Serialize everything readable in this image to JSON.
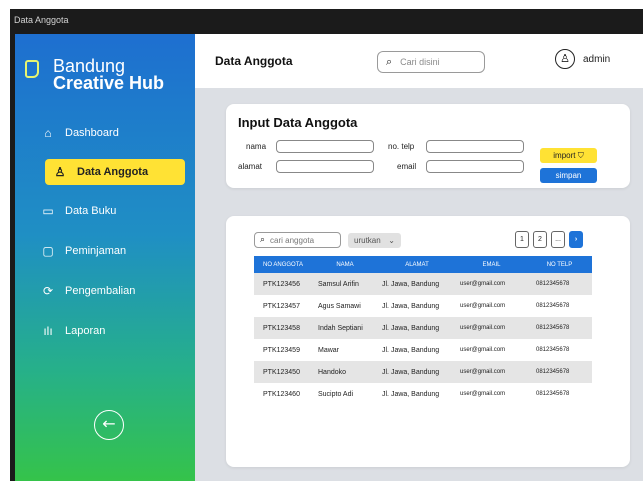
{
  "window": {
    "title": "Data Anggota"
  },
  "sidebar": {
    "brand_line1": "Bandung",
    "brand_line2": "Creative Hub",
    "items": [
      {
        "label": "Dashboard",
        "icon": "home-icon",
        "active": false
      },
      {
        "label": "Data Anggota",
        "icon": "user-icon",
        "active": true
      },
      {
        "label": "Data Buku",
        "icon": "book-icon",
        "active": false
      },
      {
        "label": "Peminjaman",
        "icon": "folder-icon",
        "active": false
      },
      {
        "label": "Pengembalian",
        "icon": "refresh-icon",
        "active": false
      },
      {
        "label": "Laporan",
        "icon": "bar-chart-icon",
        "active": false
      }
    ],
    "back_icon": "arrow-left-circle-icon"
  },
  "header": {
    "title": "Data Anggota",
    "search_placeholder": "Cari disini",
    "user_name": "admin"
  },
  "form": {
    "heading": "Input Data Anggota",
    "nama_label": "nama",
    "alamat_label": "alamat",
    "telp_label": "no. telp",
    "email_label": "email",
    "nama_value": "",
    "alamat_value": "",
    "telp_value": "",
    "email_value": "",
    "import_label": "import",
    "save_label": "simpan"
  },
  "table": {
    "search_placeholder": "cari anggota",
    "sort_label": "urutkan",
    "pages": [
      "1",
      "2",
      "..."
    ],
    "columns": [
      "NO ANGGOTA",
      "NAMA",
      "ALAMAT",
      "EMAIL",
      "NO TELP"
    ],
    "rows": [
      [
        "PTK123456",
        "Samsul Arifin",
        "Jl. Jawa, Bandung",
        "user@gmail.com",
        "0812345678"
      ],
      [
        "PTK123457",
        "Agus Samawi",
        "Jl. Jawa, Bandung",
        "user@gmail.com",
        "0812345678"
      ],
      [
        "PTK123458",
        "Indah Septiani",
        "Jl. Jawa, Bandung",
        "user@gmail.com",
        "0812345678"
      ],
      [
        "PTK123459",
        "Mawar",
        "Jl. Jawa, Bandung",
        "user@gmail.com",
        "0812345678"
      ],
      [
        "PTK123450",
        "Handoko",
        "Jl. Jawa, Bandung",
        "user@gmail.com",
        "0812345678"
      ],
      [
        "PTK123460",
        "Sucipto Adi",
        "Jl. Jawa, Bandung",
        "user@gmail.com",
        "0812345678"
      ]
    ]
  },
  "colors": {
    "accent_blue": "#1e73d8",
    "accent_yellow": "#ffe234",
    "sidebar_top": "#1e6fd0",
    "sidebar_bottom": "#35c34a"
  }
}
